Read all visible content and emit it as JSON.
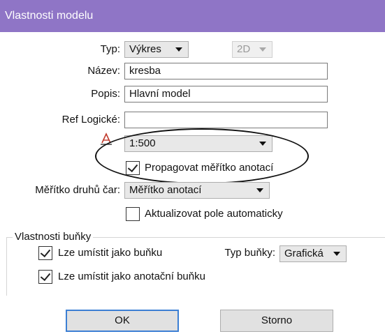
{
  "window": {
    "title": "Vlastnosti modelu"
  },
  "fields": {
    "type_label": "Typ:",
    "type_value": "Výkres",
    "dim_value": "2D",
    "name_label": "Název:",
    "name_value": "kresba",
    "desc_label": "Popis:",
    "desc_value": "Hlavní model",
    "ref_label": "Ref Logické:",
    "ref_value": "",
    "scale_value": "1:500",
    "propagate_label": "Propagovat měřítko anotací",
    "linescale_label": "Měřítko druhů čar:",
    "linescale_value": "Měřítko anotací",
    "autoupdate_label": "Aktualizovat pole automaticky"
  },
  "checkboxes": {
    "propagate": true,
    "autoupdate": false,
    "cell": true,
    "annot_cell": true
  },
  "cell": {
    "group_title": "Vlastnosti buňky",
    "place_as_cell_label": "Lze umístit jako buňku",
    "cell_type_label": "Typ buňky:",
    "cell_type_value": "Grafická",
    "place_as_annot_cell_label": "Lze umístit jako anotační buňku"
  },
  "buttons": {
    "ok": "OK",
    "cancel": "Storno"
  },
  "colors": {
    "titlebar": "#8f75c6",
    "default_button_border": "#3c7fd4",
    "scale_icon": "#c0392b"
  },
  "icons": {
    "annotation_scale": "annotation-scale-icon"
  }
}
